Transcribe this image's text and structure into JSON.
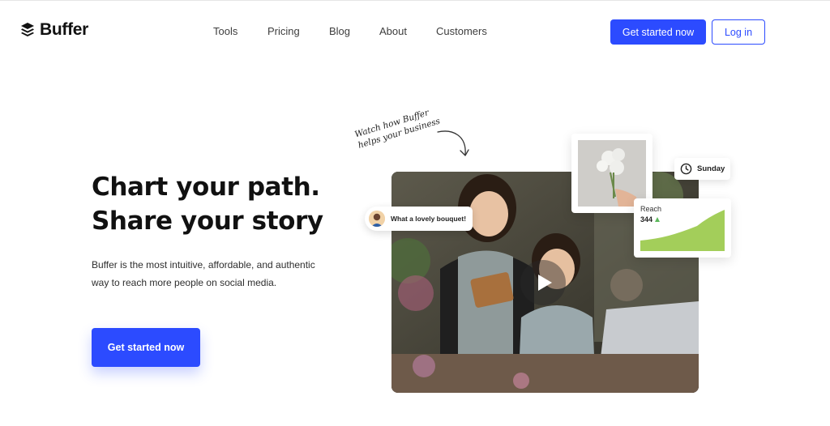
{
  "brand": {
    "name": "Buffer",
    "accent": "#2c4bff"
  },
  "nav": {
    "items": [
      "Tools",
      "Pricing",
      "Blog",
      "About",
      "Customers"
    ]
  },
  "header": {
    "cta_label": "Get started now",
    "login_label": "Log in"
  },
  "hero": {
    "title_line1": "Chart your path.",
    "title_line2": "Share your story",
    "subtitle": "Buffer is the most intuitive, affordable, and authentic way to reach more people on social media.",
    "cta_label": "Get started now"
  },
  "visual": {
    "annotation_line1": "Watch how Buffer",
    "annotation_line2": "helps your business",
    "comment_text": "What a lovely bouquet!",
    "day_label": "Sunday",
    "reach_label": "Reach",
    "reach_value": "344",
    "icons": [
      "play-icon",
      "clock-icon",
      "arrow-icon",
      "trend-up-icon"
    ]
  }
}
